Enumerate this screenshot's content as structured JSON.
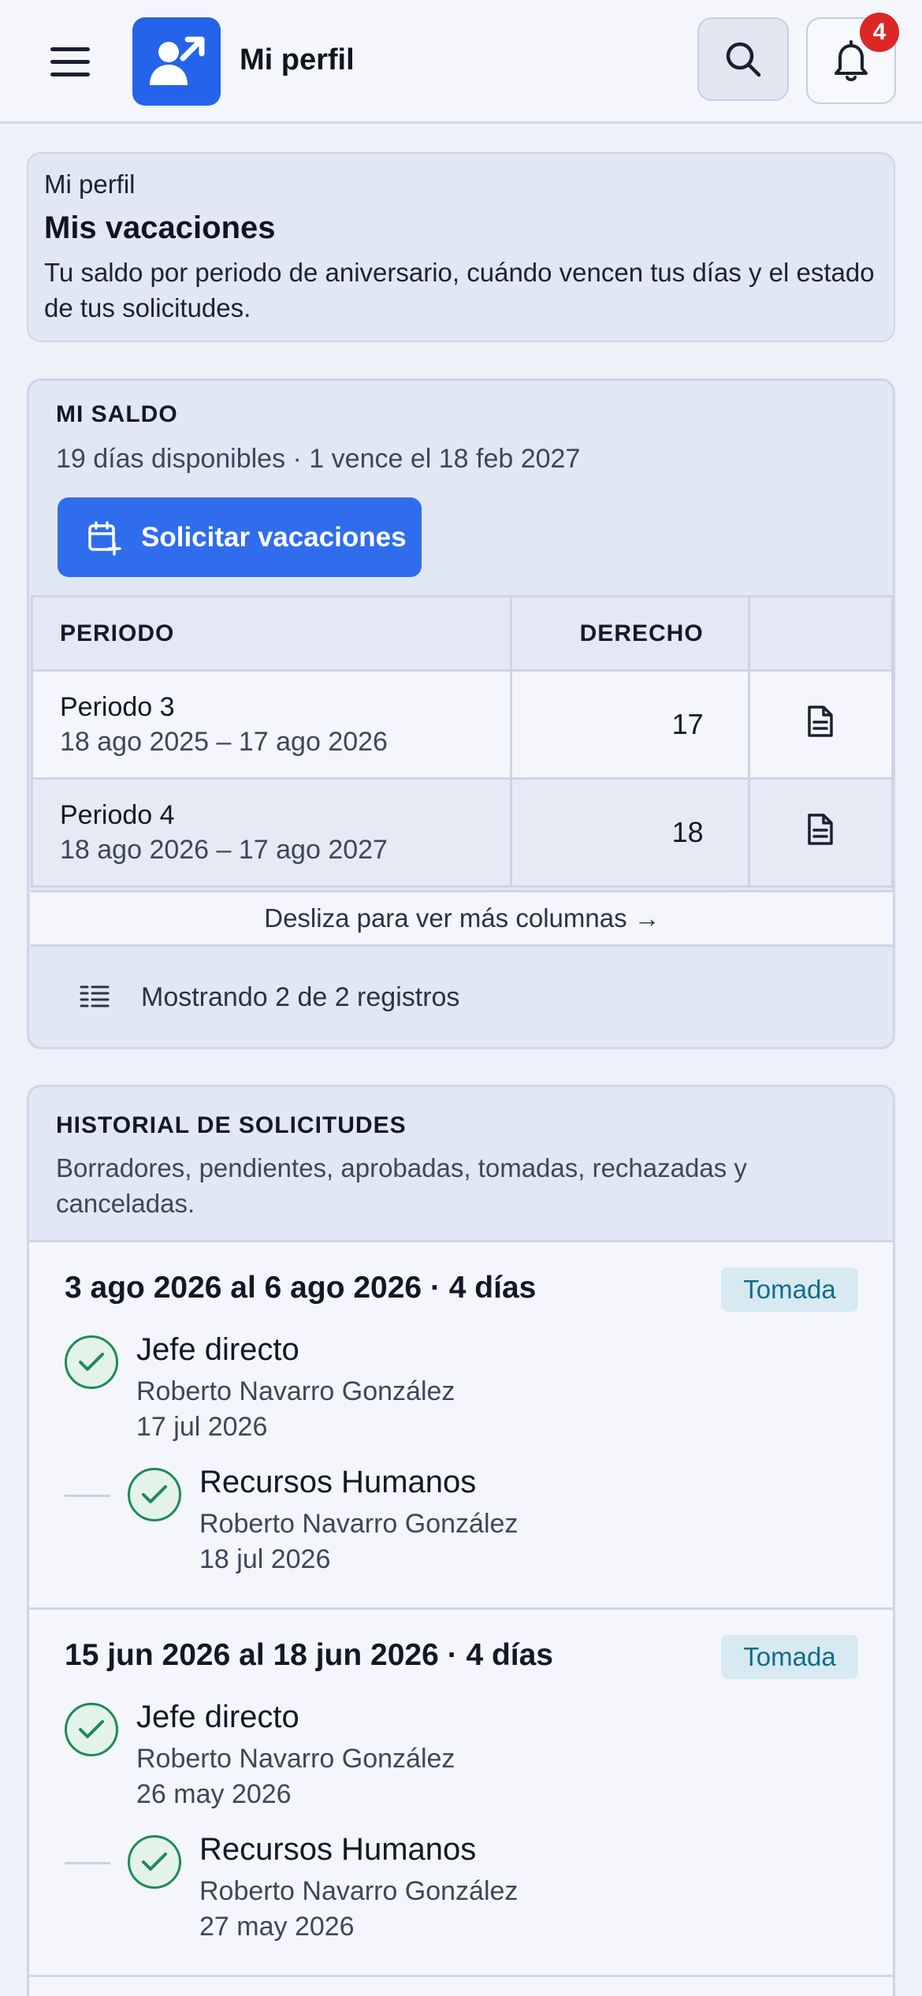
{
  "header": {
    "title": "Mi perfil",
    "menu_icon": "hamburger-menu-icon",
    "logo_icon": "user-arrow-icon",
    "search_icon": "search-icon",
    "bell_icon": "bell-icon",
    "notification_count": "4",
    "accent": "#2563eb"
  },
  "intro": {
    "breadcrumb": "Mi perfil",
    "title": "Mis vacaciones",
    "description": "Tu saldo por periodo de aniversario, cuándo vencen tus días y el estado de tus solicitudes."
  },
  "saldo": {
    "title": "MI SALDO",
    "summary": "19 días disponibles · 1 vence el 18 feb 2027",
    "cta_label": "Solicitar vacaciones",
    "columns": [
      "PERIODO",
      "DERECHO",
      ""
    ],
    "rows": [
      {
        "name": "Periodo 3",
        "dates": "18 ago 2025 – 17 ago 2026",
        "entitlement": "17"
      },
      {
        "name": "Periodo 4",
        "dates": "18 ago 2026 – 17 ago 2027",
        "entitlement": "18"
      }
    ],
    "scroll_hint": "Desliza para ver más columnas →",
    "records_text": "Mostrando 2 de 2 registros"
  },
  "history": {
    "title": "HISTORIAL DE SOLICITUDES",
    "description": "Borradores, pendientes, aprobadas, tomadas, rechazadas y canceladas.",
    "requests": [
      {
        "title": "3 ago 2026 al 6 ago 2026 · 4 días",
        "status": "Tomada",
        "approvals": [
          {
            "role": "Jefe directo",
            "approver": "Roberto Navarro González",
            "date": "17 jul 2026"
          },
          {
            "role": "Recursos Humanos",
            "approver": "Roberto Navarro González",
            "date": "18 jul 2026"
          }
        ]
      },
      {
        "title": "15 jun 2026 al 18 jun 2026 · 4 días",
        "status": "Tomada",
        "approvals": [
          {
            "role": "Jefe directo",
            "approver": "Roberto Navarro González",
            "date": "26 may 2026"
          },
          {
            "role": "Recursos Humanos",
            "approver": "Roberto Navarro González",
            "date": "27 may 2026"
          }
        ]
      }
    ]
  }
}
